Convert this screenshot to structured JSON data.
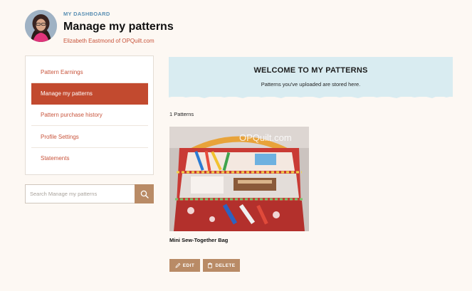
{
  "header": {
    "eyebrow": "MY DASHBOARD",
    "title": "Manage my patterns",
    "subtitle": "Elizabeth Eastmond of OPQuilt.com"
  },
  "sidebar": {
    "items": [
      {
        "label": "Pattern Earnings",
        "active": false
      },
      {
        "label": "Manage my patterns",
        "active": true
      },
      {
        "label": "Pattern purchase history",
        "active": false
      },
      {
        "label": "Profile Settings",
        "active": false
      },
      {
        "label": "Statements",
        "active": false
      }
    ]
  },
  "search": {
    "placeholder": "Search Manage my patterns",
    "icon": "search-icon"
  },
  "banner": {
    "title": "WELCOME TO MY PATTERNS",
    "subtitle": "Patterns you've uploaded are stored here."
  },
  "patterns": {
    "count_label": "1 Patterns",
    "items": [
      {
        "name": "Mini Sew-Together Bag",
        "watermark": "OPQuilt.com",
        "edit_label": "EDIT",
        "delete_label": "DELETE",
        "edit_icon": "pencil-icon",
        "delete_icon": "trash-icon"
      }
    ]
  },
  "colors": {
    "accent": "#c24a2f",
    "link": "#c8533a",
    "button": "#b98b66",
    "banner": "#d9ecf1",
    "eyebrow": "#5a8fb3",
    "background": "#fdf8f3"
  }
}
